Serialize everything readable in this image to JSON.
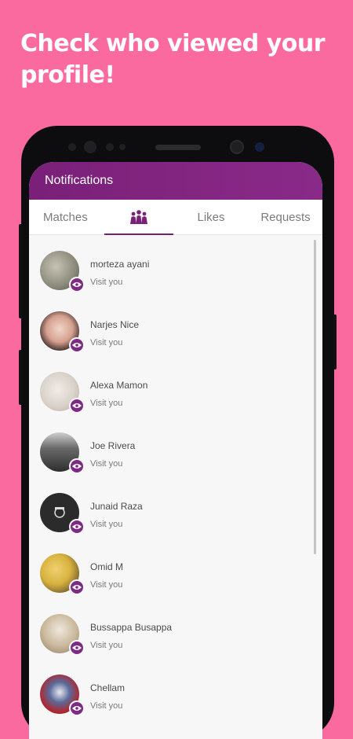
{
  "promo": {
    "headline_line1": "Check who viewed your",
    "headline_line2": "profile!"
  },
  "app": {
    "title": "Notifications",
    "accent_color": "#7a2079",
    "tabs": [
      {
        "label": "Matches",
        "active": false
      },
      {
        "label": "",
        "icon": "visitors-icon",
        "active": true
      },
      {
        "label": "Likes",
        "active": false
      },
      {
        "label": "Requests",
        "active": false
      }
    ]
  },
  "notifications": [
    {
      "name": "morteza ayani",
      "action": "Visit you",
      "avatar_color": "#8a8a7a",
      "badge_icon": "eye-icon"
    },
    {
      "name": "Narjes Nice",
      "action": "Visit you",
      "avatar_color": "#e8c6b8",
      "badge_icon": "eye-icon"
    },
    {
      "name": "Alexa Mamon",
      "action": "Visit you",
      "avatar_color": "#d9d2cb",
      "badge_icon": "eye-icon"
    },
    {
      "name": "Joe Rivera",
      "action": "Visit you",
      "avatar_color": "#5a5a5a",
      "badge_icon": "eye-icon"
    },
    {
      "name": "Junaid Raza",
      "action": "Visit you",
      "avatar_color": "#2b2b2b",
      "badge_icon": "eye-icon"
    },
    {
      "name": "Omid M",
      "action": "Visit you",
      "avatar_color": "#d7b23e",
      "badge_icon": "eye-icon"
    },
    {
      "name": "Bussappa Busappa",
      "action": "Visit you",
      "avatar_color": "#c9b79b",
      "badge_icon": "eye-icon"
    },
    {
      "name": "Chellam",
      "action": "Visit you",
      "avatar_color": "#b4232a",
      "badge_icon": "eye-icon"
    }
  ]
}
